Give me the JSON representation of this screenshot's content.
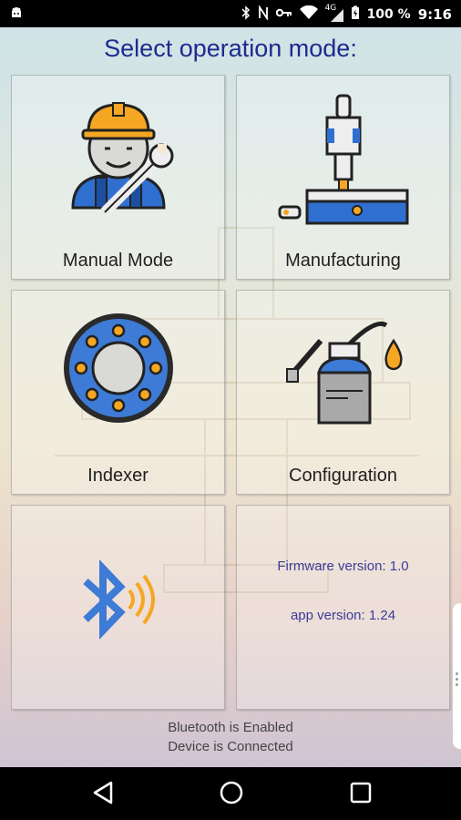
{
  "statusbar": {
    "network": "4G",
    "battery": "100 %",
    "time": "9:16",
    "icons": [
      "android-icon",
      "bluetooth-icon",
      "nfc-icon",
      "vpn-key-icon",
      "wifi-icon",
      "signal-icon",
      "battery-icon"
    ]
  },
  "header": {
    "title": "Select operation mode:"
  },
  "tiles": [
    {
      "label": "Manual Mode",
      "icon": "worker-wrench-icon"
    },
    {
      "label": "Manufacturing",
      "icon": "milling-machine-icon"
    },
    {
      "label": "Indexer",
      "icon": "indexer-disc-icon"
    },
    {
      "label": "Configuration",
      "icon": "oil-can-icon"
    },
    {
      "label": "",
      "icon": "bluetooth-signal-icon"
    }
  ],
  "info": {
    "firmware": "Firmware version: 1.0",
    "app": "app version: 1.24"
  },
  "footer": {
    "bluetooth_status": "Bluetooth is Enabled",
    "device_status": "Device is Connected"
  },
  "navbar": {
    "icons": [
      "back-icon",
      "home-icon",
      "recents-icon"
    ]
  },
  "colors": {
    "title": "#1d2a8f",
    "info_text": "#3a3c9a",
    "accent_blue": "#3d7bd6",
    "accent_orange": "#f5a623"
  }
}
